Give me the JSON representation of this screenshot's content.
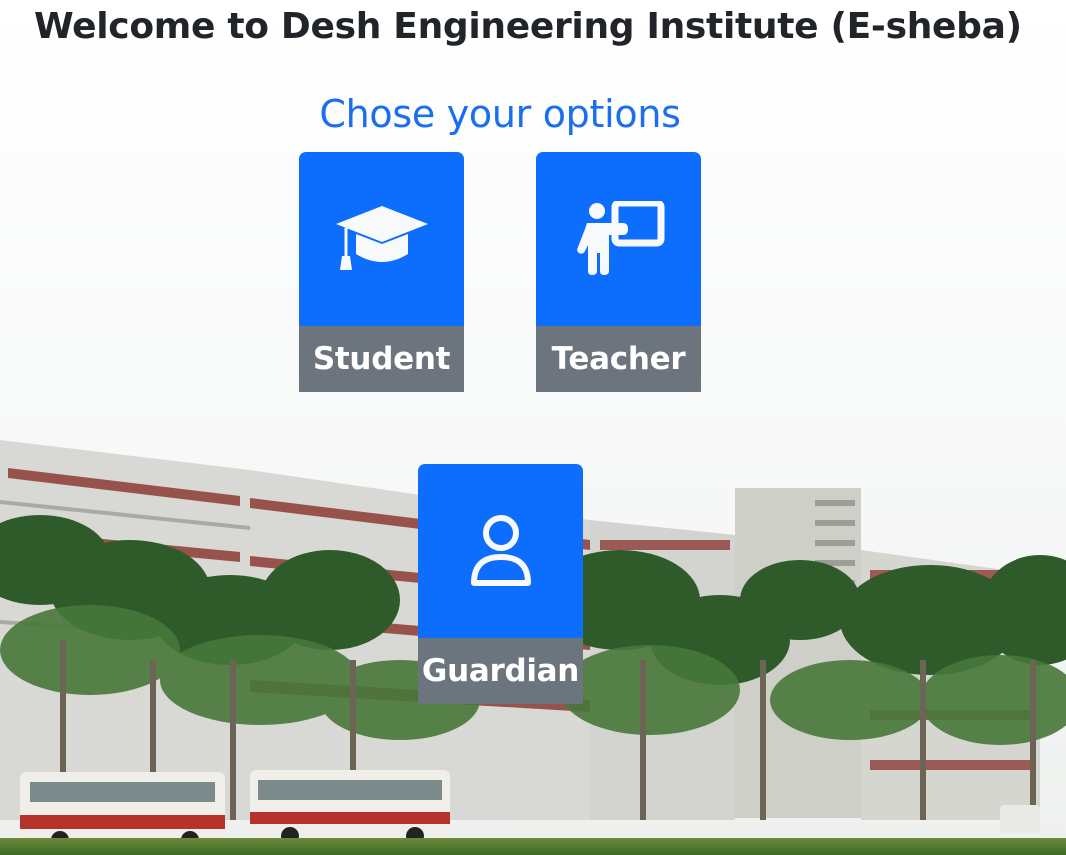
{
  "header": {
    "title": "Welcome to Desh Engineering Institute (E-sheba)",
    "subtitle": "Chose your options"
  },
  "options": [
    {
      "label": "Student",
      "icon": "graduation-cap-icon"
    },
    {
      "label": "Teacher",
      "icon": "chalkboard-teacher-icon"
    },
    {
      "label": "Guardian",
      "icon": "person-icon"
    }
  ],
  "colors": {
    "card_top": "#0d6efd",
    "card_label_bg": "#6c757d",
    "subtitle": "#1a6ef0",
    "title": "#212529"
  }
}
